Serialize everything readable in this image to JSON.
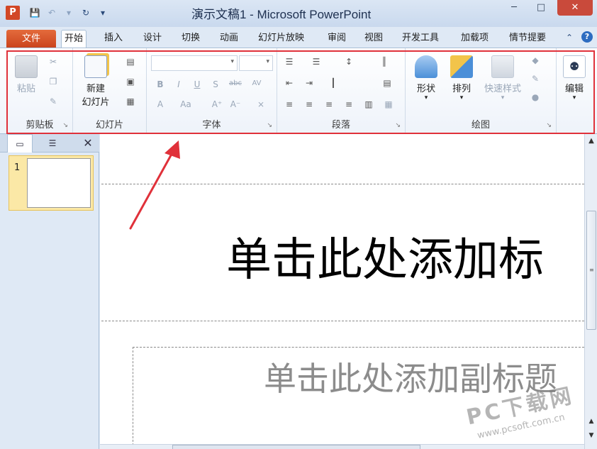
{
  "window": {
    "title": "演示文稿1 - Microsoft PowerPoint",
    "app_icon_letter": "P"
  },
  "tabs": {
    "file": "文件",
    "items": [
      "开始",
      "插入",
      "设计",
      "切换",
      "动画",
      "幻灯片放映",
      "审阅",
      "视图",
      "开发工具",
      "加载项",
      "情节提要"
    ],
    "active": "开始"
  },
  "ribbon": {
    "clipboard": {
      "label": "剪贴板",
      "paste": "粘贴"
    },
    "slides": {
      "label": "幻灯片",
      "new_slide_line1": "新建",
      "new_slide_line2": "幻灯片"
    },
    "font": {
      "label": "字体",
      "font_name": "",
      "font_size": ""
    },
    "paragraph": {
      "label": "段落"
    },
    "drawing": {
      "label": "绘图",
      "shapes": "形状",
      "arrange": "排列",
      "quick_styles": "快速样式"
    },
    "editing": {
      "label": "编辑",
      "edit": "编辑"
    }
  },
  "left_panel": {
    "slide_number": "1"
  },
  "slide": {
    "title_placeholder": "单击此处添加标",
    "subtitle_placeholder": "单击此处添加副标题"
  },
  "watermark": {
    "main": "PC下载网",
    "url": "www.pcsoft.com.cn"
  },
  "colors": {
    "highlight_border": "#e0313a",
    "file_tab": "#d24726",
    "arrow": "#e0313a"
  }
}
